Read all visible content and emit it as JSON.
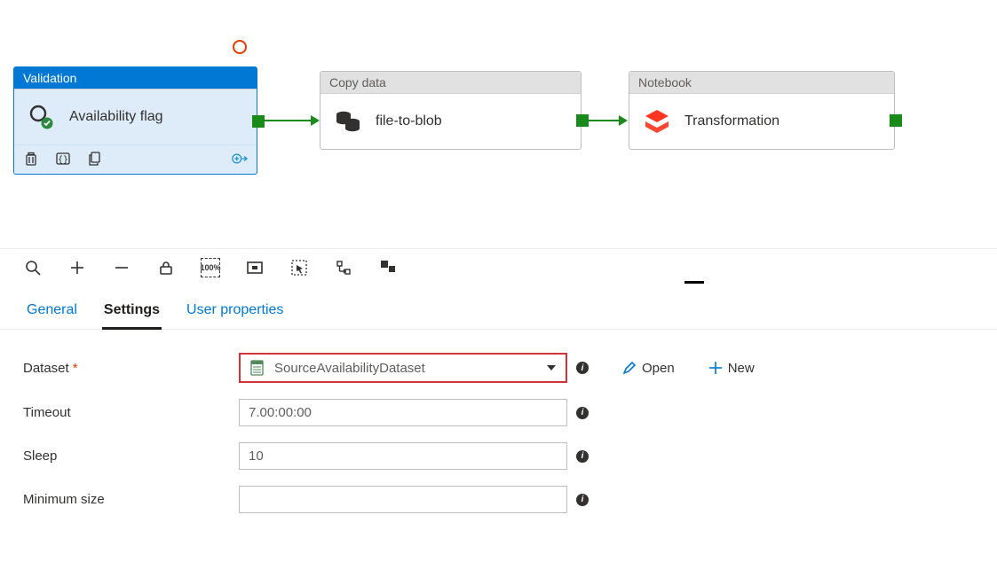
{
  "pipeline": {
    "activities": [
      {
        "type": "Validation",
        "name": "Availability flag",
        "selected": true
      },
      {
        "type": "Copy data",
        "name": "file-to-blob",
        "selected": false
      },
      {
        "type": "Notebook",
        "name": "Transformation",
        "selected": false
      }
    ]
  },
  "tabs": {
    "general": "General",
    "settings": "Settings",
    "userProps": "User properties",
    "active": "settings"
  },
  "settings": {
    "datasetLabel": "Dataset",
    "datasetValue": "SourceAvailabilityDataset",
    "timeoutLabel": "Timeout",
    "timeoutValue": "7.00:00:00",
    "sleepLabel": "Sleep",
    "sleepValue": "10",
    "minSizeLabel": "Minimum size",
    "minSizeValue": "",
    "openLabel": "Open",
    "newLabel": "New"
  }
}
